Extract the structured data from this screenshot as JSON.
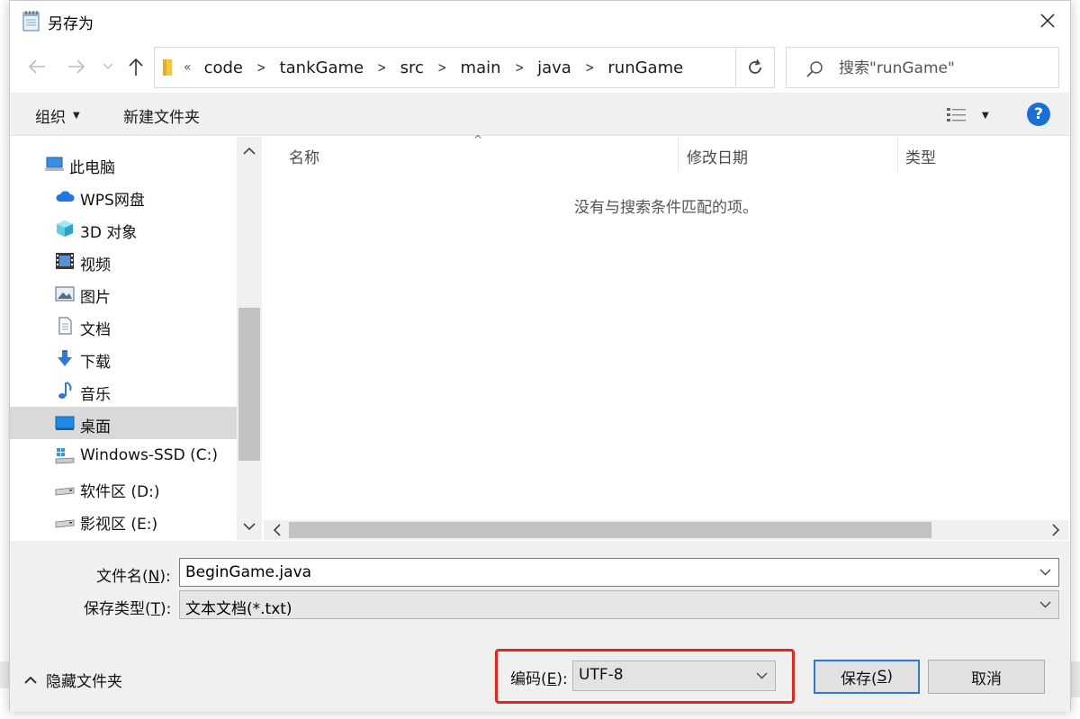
{
  "window": {
    "title": "另存为",
    "close_label": "✕"
  },
  "navigation": {
    "breadcrumb_start": "«",
    "breadcrumbs": [
      "code",
      "tankGame",
      "src",
      "main",
      "java",
      "runGame"
    ],
    "search_placeholder": "搜索\"runGame\""
  },
  "toolbar": {
    "organize_label": "组织",
    "new_folder_label": "新建文件夹",
    "help_label": "?"
  },
  "sidebar": {
    "items": [
      {
        "label": "此电脑",
        "icon": "computer-icon"
      },
      {
        "label": "WPS网盘",
        "icon": "cloud-icon"
      },
      {
        "label": "3D 对象",
        "icon": "3d-objects-icon"
      },
      {
        "label": "视频",
        "icon": "video-icon"
      },
      {
        "label": "图片",
        "icon": "pictures-icon"
      },
      {
        "label": "文档",
        "icon": "documents-icon"
      },
      {
        "label": "下载",
        "icon": "download-icon"
      },
      {
        "label": "音乐",
        "icon": "music-icon"
      },
      {
        "label": "桌面",
        "icon": "desktop-icon",
        "selected": true
      },
      {
        "label": "Windows-SSD (C:)",
        "icon": "windows-drive-icon"
      },
      {
        "label": "软件区 (D:)",
        "icon": "drive-icon"
      },
      {
        "label": "影视区 (E:)",
        "icon": "drive-icon"
      }
    ]
  },
  "file_list": {
    "columns": [
      "名称",
      "修改日期",
      "类型"
    ],
    "empty_message": "没有与搜索条件匹配的项。"
  },
  "form": {
    "filename_label_prefix": "文件名(",
    "filename_label_key": "N",
    "filename_label_suffix": "):",
    "filename_value": "BeginGame.java",
    "filetype_label_prefix": "保存类型(",
    "filetype_label_key": "T",
    "filetype_label_suffix": "):",
    "filetype_value": "文本文档(*.txt)",
    "encoding_label_prefix": "编码(",
    "encoding_label_key": "E",
    "encoding_label_suffix": "):",
    "encoding_value": "UTF-8"
  },
  "footer": {
    "hide_folders_label": "隐藏文件夹",
    "save_label_prefix": "保存(",
    "save_label_key": "S",
    "save_label_suffix": ")",
    "cancel_label": "取消"
  },
  "colors": {
    "highlight": "#e8241c",
    "accent": "#2e79d6",
    "selected_row": "#d9d9d9"
  }
}
